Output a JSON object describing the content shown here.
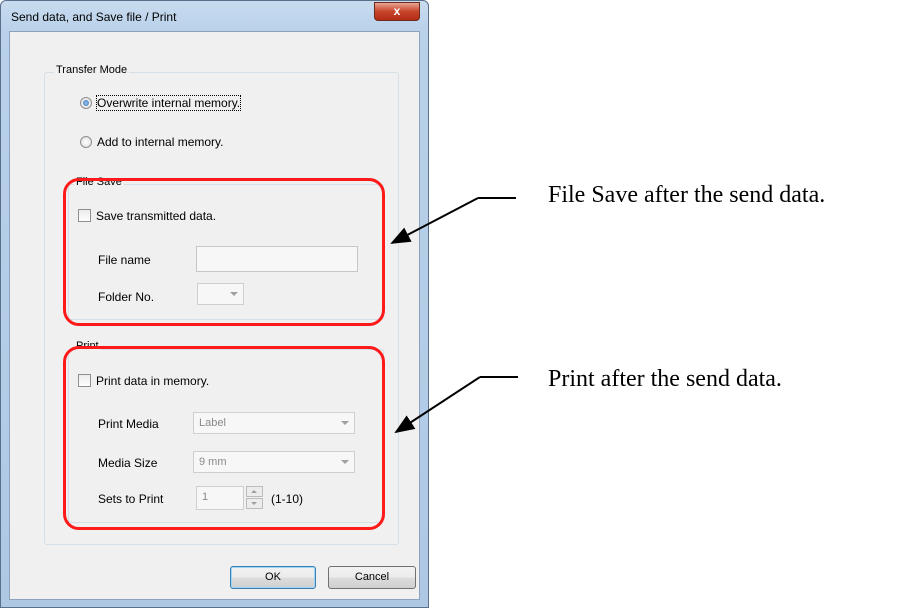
{
  "window": {
    "title": "Send data, and Save file / Print",
    "close_glyph": "x"
  },
  "transfer_mode": {
    "label": "Transfer Mode",
    "options": [
      {
        "label": "Overwrite internal memory.",
        "selected": true
      },
      {
        "label": "Add to internal memory.",
        "selected": false
      }
    ]
  },
  "file_save": {
    "label": "File Save",
    "checkbox_label": "Save transmitted data.",
    "checked": false,
    "file_name_label": "File name",
    "file_name_value": "",
    "folder_label": "Folder No.",
    "folder_value": ""
  },
  "print": {
    "label": "Print",
    "checkbox_label": "Print data in memory.",
    "checked": false,
    "media_label": "Print Media",
    "media_value": "Label",
    "size_label": "Media Size",
    "size_value": "9 mm",
    "sets_label": "Sets to Print",
    "sets_value": "1",
    "sets_range": "(1-10)"
  },
  "buttons": {
    "ok": "OK",
    "cancel": "Cancel"
  },
  "annotations": {
    "file_save_note": "File Save after the send data.",
    "print_note": "Print after the send data.",
    "highlight_color": "#ff1a1a"
  }
}
